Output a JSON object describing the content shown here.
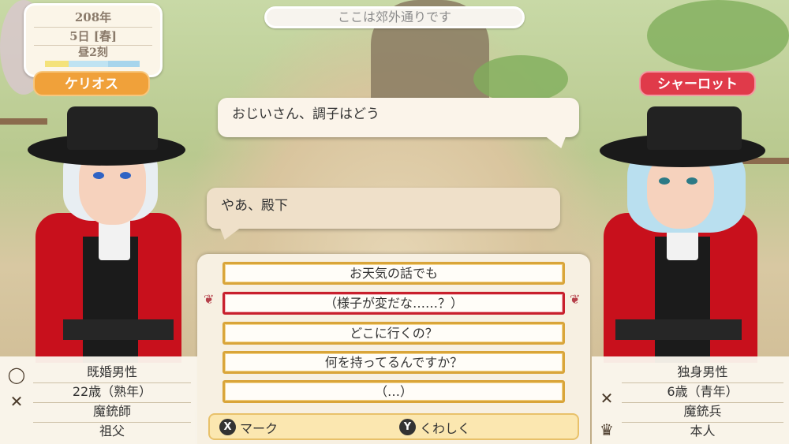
{
  "date": {
    "year": "208年",
    "day": "5日 [春]",
    "time": "昼2刻",
    "day_phase_colors": [
      "#f4e27a",
      "#bfe3f2",
      "#a7d5ec"
    ]
  },
  "location": {
    "text": "ここは郊外通りです"
  },
  "speaker_left": {
    "name": "ケリオス",
    "badge_color": "#f0a13a",
    "profile": [
      "既婚男性",
      "22歳（熟年）",
      "魔銃師",
      "祖父"
    ],
    "icons": [
      "ring-icon",
      "crossed-guns-icon"
    ]
  },
  "speaker_right": {
    "name": "シャーロット",
    "badge_color": "#e03a4a",
    "profile": [
      "独身男性",
      "6歳（青年）",
      "魔銃兵",
      "本人"
    ],
    "icons": [
      "crossed-guns-icon",
      "crown-icon"
    ]
  },
  "dialogue": {
    "line1": "おじいさん、調子はどう",
    "line2": "やあ、殿下"
  },
  "choices": [
    "お天気の話でも",
    "（様子が変だな……？）",
    "どこに行くの？",
    "何を持ってるんですか？",
    "（…）"
  ],
  "selected_choice_index": 1,
  "hints": {
    "mark_button": "X",
    "mark_label": "マーク",
    "detail_button": "Y",
    "detail_label": "くわしく"
  }
}
